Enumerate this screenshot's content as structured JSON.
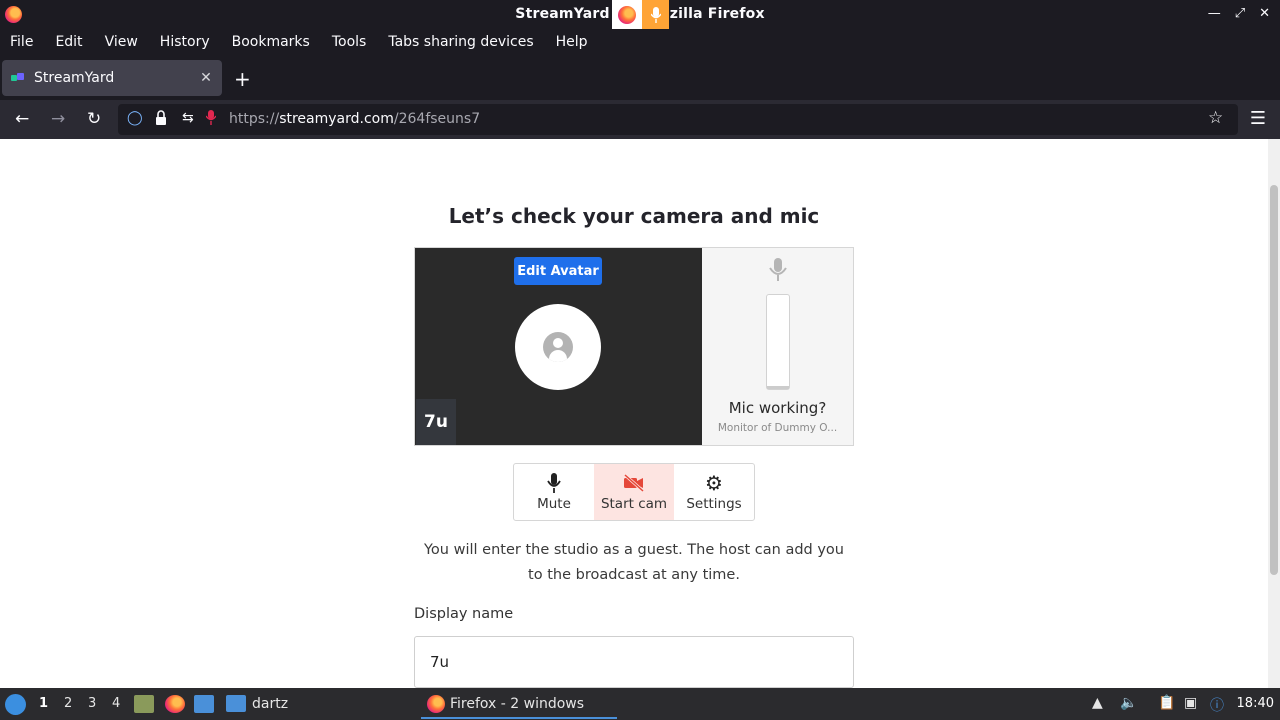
{
  "window": {
    "title": "StreamYard — Mozilla Firefox",
    "title_visible": "StreamYard",
    "title_visible_tail": "zilla Firefox"
  },
  "menubar": {
    "items": [
      "File",
      "Edit",
      "View",
      "History",
      "Bookmarks",
      "Tools",
      "Tabs sharing devices",
      "Help"
    ]
  },
  "tabs": [
    {
      "title": "StreamYard",
      "active": true
    }
  ],
  "navbar": {
    "url_prefix": "https://",
    "url_host": "streamyard.com",
    "url_path": "/264fseuns7"
  },
  "page": {
    "heading": "Let’s check your camera and mic",
    "edit_avatar": "Edit Avatar",
    "name_tag": "7u",
    "mic_label": "Mic working?",
    "mic_device": "Monitor of Dummy O...",
    "mic_level": 0.03,
    "controls": {
      "mute": "Mute",
      "start_cam": "Start cam",
      "settings": "Settings"
    },
    "info_line1": "You will enter the studio as a guest. The host can add you",
    "info_line2": "to the broadcast at any time.",
    "display_name_label": "Display name",
    "display_name_value": "7u"
  },
  "taskbar": {
    "workspaces": [
      "1",
      "2",
      "3",
      "4"
    ],
    "active_workspace": "1",
    "folder_label": "dartz",
    "window_button": "Firefox - 2 windows",
    "clock": "18:40"
  },
  "colors": {
    "accent": "#1f6feb",
    "cam_active_bg": "#fde4e1",
    "cam_icon": "#e5483a"
  }
}
